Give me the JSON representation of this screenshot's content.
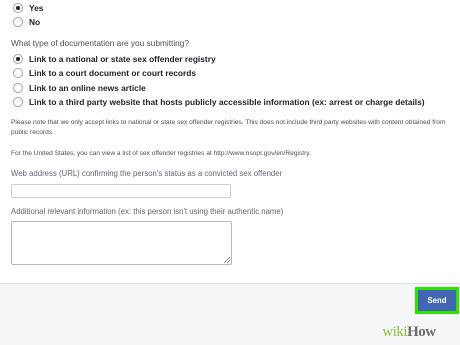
{
  "report_question": {
    "options": [
      {
        "label": "Yes",
        "selected": true
      },
      {
        "label": "No",
        "selected": false
      }
    ]
  },
  "documentation": {
    "question": "What type of documentation are you submitting?",
    "options": [
      {
        "label": "Link to a national or state sex offender registry",
        "selected": true
      },
      {
        "label": "Link to a court document or court records",
        "selected": false
      },
      {
        "label": "Link to an online news article",
        "selected": false
      },
      {
        "label": "Link to a third party website that hosts publicly accessible information (ex: arrest or charge details)",
        "selected": false
      }
    ]
  },
  "notes": {
    "registry_note": "Please note that we only accept links to national or state sex offender registries. This does not include third party websites with content obtained from public records.",
    "us_note": "For the United States, you can view a list of sex offender registries at http://www.nsopr.gov/en/Registry."
  },
  "fields": {
    "url_label": "Web address (URL) confirming the person's status as a convicted sex offender",
    "url_value": "",
    "additional_label": "Additional relevant information (ex: this person isn't using their authentic name)",
    "additional_value": ""
  },
  "footer": {
    "send_label": "Send"
  },
  "watermark": {
    "wiki": "wiki",
    "how": "How"
  },
  "colors": {
    "send_button": "#4267b2",
    "highlight": "#2fe000",
    "footer_bg": "#f5f6f7"
  }
}
